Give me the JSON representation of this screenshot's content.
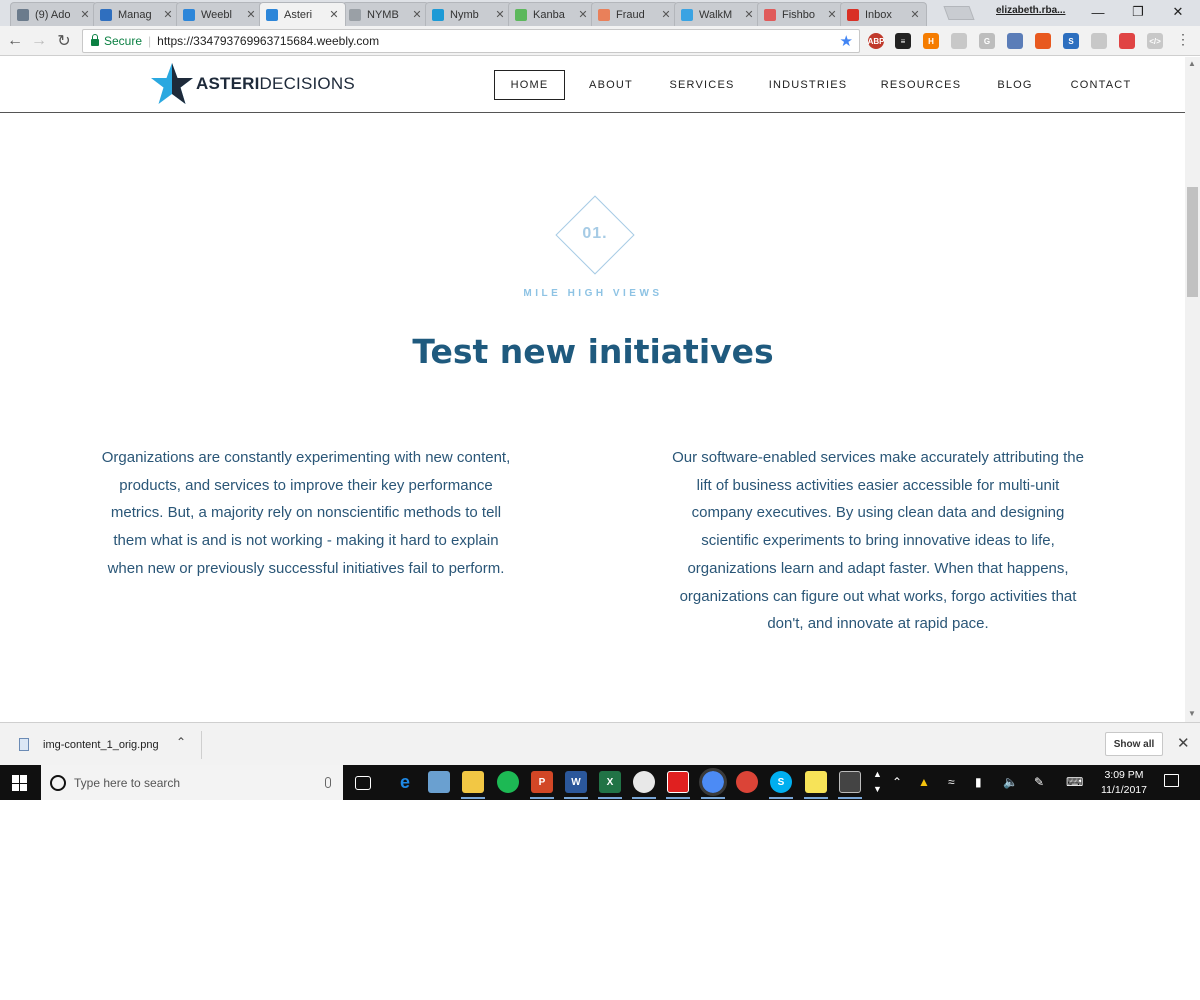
{
  "browser": {
    "tabs": [
      {
        "label": "(9) Ado",
        "icon": "document-icon",
        "color": "#6b7b8c"
      },
      {
        "label": "Manag",
        "icon": "sun-gear-icon",
        "color": "#2f6fbf"
      },
      {
        "label": "Weebl",
        "icon": "weebly-w-icon",
        "color": "#2d86d9"
      },
      {
        "label": "Asteri",
        "icon": "weebly-w-icon",
        "color": "#2d86d9"
      },
      {
        "label": "NYMB",
        "icon": "page-icon",
        "color": "#9aa0a6"
      },
      {
        "label": "Nymb",
        "icon": "fish-icon",
        "color": "#1c9ad6"
      },
      {
        "label": "Kanba",
        "icon": "play-icon",
        "color": "#5cb85c"
      },
      {
        "label": "Fraud",
        "icon": "puzzle-icon",
        "color": "#e9805a"
      },
      {
        "label": "WalkM",
        "icon": "walkme-icon",
        "color": "#3aa3e3"
      },
      {
        "label": "Fishbo",
        "icon": "fishbone-icon",
        "color": "#e05a5a"
      },
      {
        "label": "Inbox",
        "icon": "gmail-icon",
        "color": "#d93025"
      }
    ],
    "profile_name": "elizabeth.rba...",
    "secure_label": "Secure",
    "url": "https://334793769963715684.weebly.com",
    "window_controls": {
      "minimize": "—",
      "restore": "❐",
      "close": "✕"
    }
  },
  "site": {
    "logo_bold": "ASTERI",
    "logo_light": "DECISIONS",
    "nav": [
      "HOME",
      "ABOUT",
      "SERVICES",
      "INDUSTRIES",
      "RESOURCES",
      "BLOG",
      "CONTACT"
    ],
    "active_nav": "HOME",
    "badge_number": "01.",
    "eyebrow": "MILE HIGH VIEWS",
    "headline": "Test new initiatives",
    "left_paragraph": "Organizations are constantly experimenting with new content, products, and services to improve their key performance metrics. But, a majority rely on nonscientific methods to tell them what is and is not working - making it hard to explain when new or previously successful initiatives fail to perform.",
    "right_paragraph": "Our software-enabled services make accurately attributing the lift of business activities easier accessible for multi-unit company executives. By using clean data and designing scientific experiments to bring innovative ideas to life, organizations learn and adapt faster. When that happens, organizations can figure out what works, forgo activities that don't, and innovate at rapid pace.",
    "colors": {
      "headline": "#1f5a7e",
      "body": "#2a5677",
      "accent": "#8ec3e4",
      "star_dark": "#1e2a3a",
      "star_light": "#2aa8e0"
    }
  },
  "download_bar": {
    "filename": "img-content_1_orig.png",
    "show_all": "Show all"
  },
  "taskbar": {
    "search_placeholder": "Type here to search",
    "time": "3:09 PM",
    "date": "11/1/2017"
  }
}
